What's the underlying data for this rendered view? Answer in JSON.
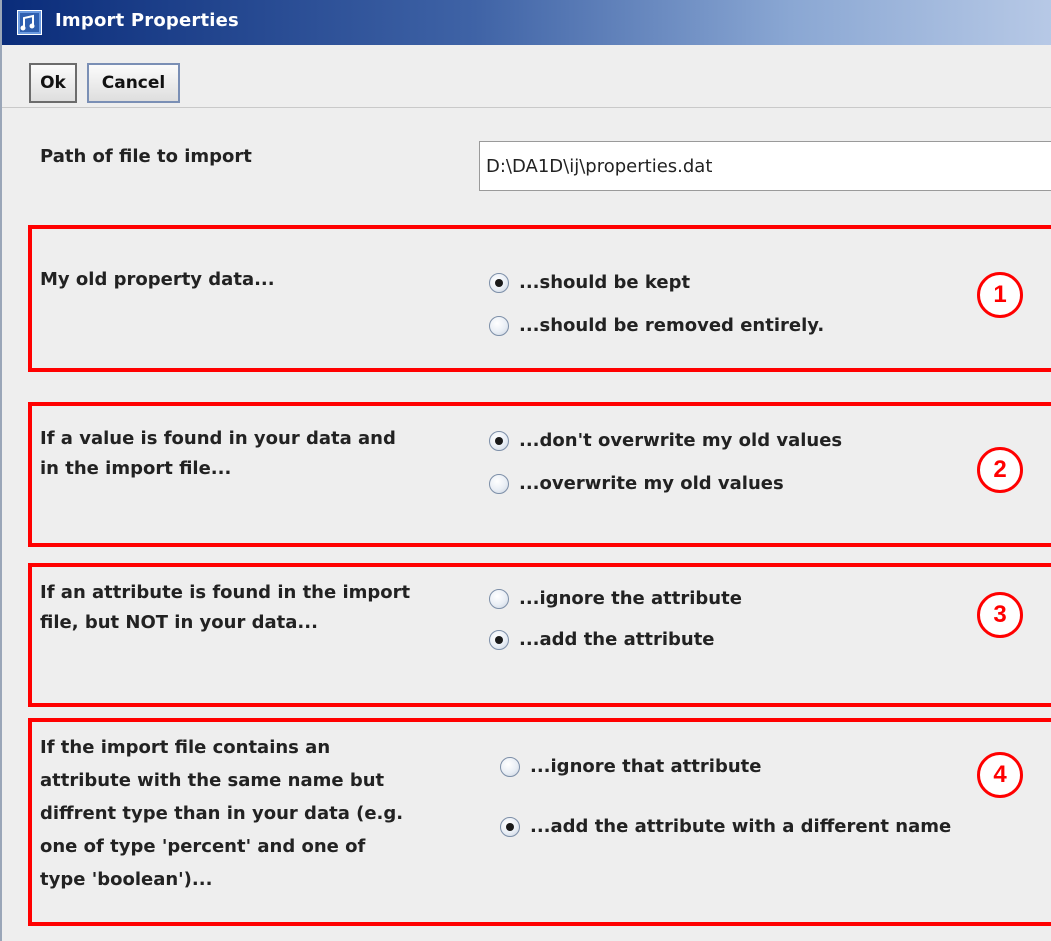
{
  "window": {
    "title": "Import Properties"
  },
  "toolbar": {
    "ok_label": "Ok",
    "cancel_label": "Cancel"
  },
  "path": {
    "label": "Path of file to import",
    "value": "D:\\DA1D\\ij\\properties.dat"
  },
  "groups": [
    {
      "badge": "1",
      "label_lines": [
        "My old property data..."
      ],
      "options": [
        {
          "label": "...should be kept",
          "selected": true
        },
        {
          "label": "...should be removed entirely.",
          "selected": false
        }
      ]
    },
    {
      "badge": "2",
      "label_lines": [
        "If a value is found in your data and",
        "in the import file..."
      ],
      "options": [
        {
          "label": "...don't overwrite my old values",
          "selected": true
        },
        {
          "label": "...overwrite my old values",
          "selected": false
        }
      ]
    },
    {
      "badge": "3",
      "label_lines": [
        "If an attribute is found in the import",
        "file, but NOT in your data..."
      ],
      "options": [
        {
          "label": "...ignore the attribute",
          "selected": false
        },
        {
          "label": "...add the attribute",
          "selected": true
        }
      ]
    },
    {
      "badge": "4",
      "label_lines": [
        "If the import file contains an",
        "attribute with the same name but",
        "diffrent type than in your data (e.g.",
        "one of type 'percent' and one of",
        "type 'boolean')..."
      ],
      "options": [
        {
          "label": "...ignore that attribute",
          "selected": false
        },
        {
          "label": "...add the attribute with a different name",
          "selected": true
        }
      ]
    }
  ],
  "colors": {
    "highlight": "#ff0000",
    "title_gradient_start": "#0a2c7a",
    "title_gradient_end": "#b7c9e6"
  }
}
